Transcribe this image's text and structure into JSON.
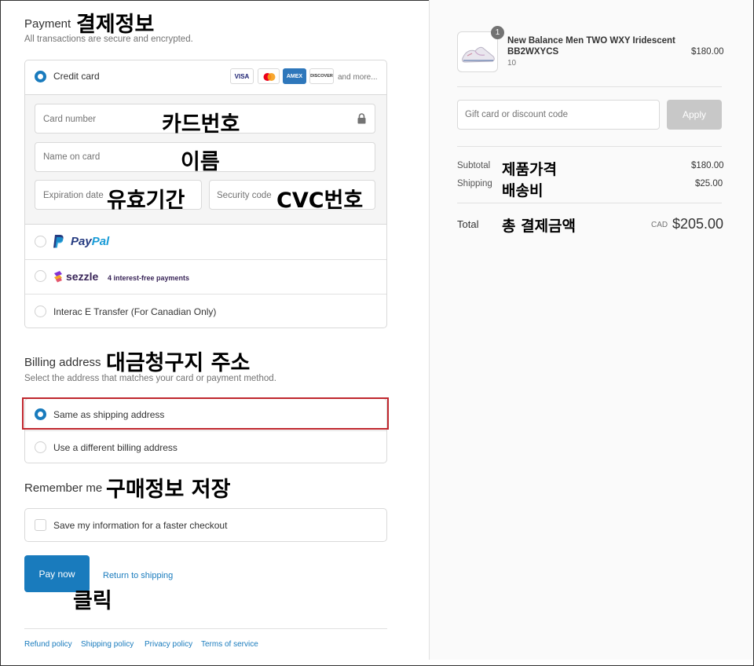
{
  "payment": {
    "title": "Payment",
    "annotation": "결제정보",
    "subtitle": "All transactions are secure and encrypted.",
    "credit_card_label": "Credit card",
    "card_logos": [
      "VISA",
      "AMEX",
      "DISCOVER"
    ],
    "and_more": "and more...",
    "card_number_placeholder": "Card number",
    "card_number_anno": "카드번호",
    "name_placeholder": "Name on card",
    "name_anno": "이름",
    "expiration_placeholder": "Expiration date",
    "expiration_anno": "유효기간",
    "security_placeholder": "Security code",
    "security_anno": "CVC번호",
    "paypal_pay": "Pay",
    "paypal_pal": "Pal",
    "sezzle_brand": "sezzle",
    "sezzle_text": "4 interest-free payments",
    "interac_label": "Interac E Transfer (For Canadian Only)"
  },
  "billing": {
    "title": "Billing address",
    "annotation": "대금청구지 주소",
    "subtitle": "Select the address that matches your card or payment method.",
    "same_label": "Same as shipping address",
    "different_label": "Use a different billing address"
  },
  "remember": {
    "title": "Remember me",
    "annotation": "구매정보 저장",
    "save_label": "Save my information for a faster checkout"
  },
  "actions": {
    "pay_now": "Pay now",
    "return_link": "Return to shipping",
    "click_anno": "클릭"
  },
  "footer": {
    "links": [
      "Refund policy",
      "Shipping policy",
      "Privacy policy",
      "Terms of service"
    ]
  },
  "order": {
    "quantity": "1",
    "product_name": "New Balance Men TWO WXY Iridescent BB2WXYCS",
    "product_variant": "10",
    "product_price": "$180.00",
    "discount_placeholder": "Gift card or discount code",
    "apply_label": "Apply",
    "subtotal_label": "Subtotal",
    "subtotal_anno": "제품가격",
    "subtotal_value": "$180.00",
    "shipping_label": "Shipping",
    "shipping_anno": "배송비",
    "shipping_value": "$25.00",
    "total_label": "Total",
    "total_anno": "총 결제금액",
    "currency": "CAD",
    "total_value": "$205.00"
  },
  "colors": {
    "accent": "#197bbd",
    "highlight_border": "#c0262d",
    "apply_bg": "#c8c8c8"
  }
}
